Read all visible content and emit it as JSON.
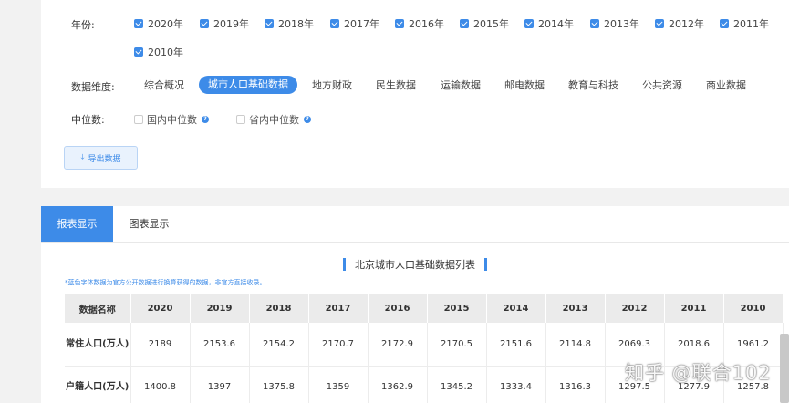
{
  "filters": {
    "year_label": "年份:",
    "years": [
      "2020年",
      "2019年",
      "2018年",
      "2017年",
      "2016年",
      "2015年",
      "2014年",
      "2013年",
      "2012年",
      "2011年",
      "2010年"
    ],
    "dimension_label": "数据维度:",
    "dimensions": [
      "综合概况",
      "城市人口基础数据",
      "地方财政",
      "民生数据",
      "运输数据",
      "邮电数据",
      "教育与科技",
      "公共资源",
      "商业数据"
    ],
    "active_dimension": "城市人口基础数据",
    "median_label": "中位数:",
    "median_options": [
      "国内中位数",
      "省内中位数"
    ],
    "export_label": "导出数据"
  },
  "tabs": [
    "报表显示",
    "图表显示"
  ],
  "table": {
    "title": "北京城市人口基础数据列表",
    "note": "*蓝色字体数据为官方公开数据进行换算获得的数据，非官方直接收录。",
    "headers": [
      "数据名称",
      "2020",
      "2019",
      "2018",
      "2017",
      "2016",
      "2015",
      "2014",
      "2013",
      "2012",
      "2011",
      "2010"
    ],
    "rows": [
      [
        "常住人口(万人)",
        "2189",
        "2153.6",
        "2154.2",
        "2170.7",
        "2172.9",
        "2170.5",
        "2151.6",
        "2114.8",
        "2069.3",
        "2018.6",
        "1961.2"
      ],
      [
        "户籍人口(万人)",
        "1400.8",
        "1397",
        "1375.8",
        "1359",
        "1362.9",
        "1345.2",
        "1333.4",
        "1316.3",
        "1297.5",
        "1277.9",
        "1257.8"
      ]
    ]
  },
  "watermark": "知乎 @联合102"
}
